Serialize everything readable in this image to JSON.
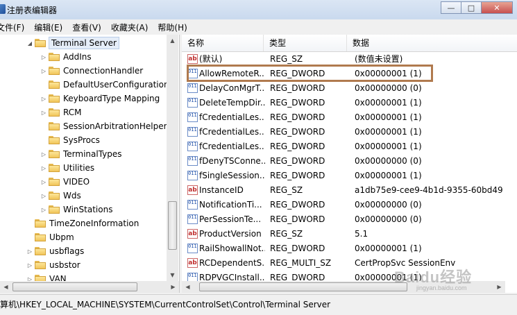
{
  "window": {
    "title": "注册表编辑器",
    "controls": {
      "minimize": "—",
      "maximize": "□",
      "close": "✕"
    }
  },
  "menu": [
    "文件(F)",
    "编辑(E)",
    "查看(V)",
    "收藏夹(A)",
    "帮助(H)"
  ],
  "tree": {
    "items": [
      {
        "label": "Terminal Server",
        "expandable": true,
        "expanded": true,
        "selected": true,
        "level": 0
      },
      {
        "label": "AddIns",
        "expandable": true,
        "level": 1
      },
      {
        "label": "ConnectionHandler",
        "expandable": true,
        "level": 1
      },
      {
        "label": "DefaultUserConfiguration",
        "expandable": false,
        "level": 1
      },
      {
        "label": "KeyboardType Mapping",
        "expandable": true,
        "level": 1
      },
      {
        "label": "RCM",
        "expandable": true,
        "level": 1
      },
      {
        "label": "SessionArbitrationHelper",
        "expandable": false,
        "level": 1
      },
      {
        "label": "SysProcs",
        "expandable": false,
        "level": 1
      },
      {
        "label": "TerminalTypes",
        "expandable": true,
        "level": 1
      },
      {
        "label": "Utilities",
        "expandable": true,
        "level": 1
      },
      {
        "label": "VIDEO",
        "expandable": true,
        "level": 1
      },
      {
        "label": "Wds",
        "expandable": true,
        "level": 1
      },
      {
        "label": "WinStations",
        "expandable": true,
        "level": 1
      },
      {
        "label": "TimeZoneInformation",
        "expandable": false,
        "level": 0
      },
      {
        "label": "Ubpm",
        "expandable": false,
        "level": 0
      },
      {
        "label": "usbflags",
        "expandable": true,
        "level": 0
      },
      {
        "label": "usbstor",
        "expandable": true,
        "level": 0
      },
      {
        "label": "VAN",
        "expandable": true,
        "level": 0
      }
    ]
  },
  "list": {
    "columns": [
      "名称",
      "类型",
      "数据"
    ],
    "rows": [
      {
        "icon": "string-value-icon",
        "name": "(默认)",
        "type": "REG_SZ",
        "data": "(数值未设置)"
      },
      {
        "icon": "binary-value-icon",
        "name": "AllowRemoteR...",
        "type": "REG_DWORD",
        "data": "0x00000001 (1)"
      },
      {
        "icon": "binary-value-icon",
        "name": "DelayConMgrT...",
        "type": "REG_DWORD",
        "data": "0x00000000 (0)"
      },
      {
        "icon": "binary-value-icon",
        "name": "DeleteTempDir...",
        "type": "REG_DWORD",
        "data": "0x00000001 (1)"
      },
      {
        "icon": "binary-value-icon",
        "name": "fCredentialLes...",
        "type": "REG_DWORD",
        "data": "0x00000001 (1)"
      },
      {
        "icon": "binary-value-icon",
        "name": "fCredentialLes...",
        "type": "REG_DWORD",
        "data": "0x00000001 (1)"
      },
      {
        "icon": "binary-value-icon",
        "name": "fCredentialLes...",
        "type": "REG_DWORD",
        "data": "0x00000001 (1)"
      },
      {
        "icon": "binary-value-icon",
        "name": "fDenyTSConne...",
        "type": "REG_DWORD",
        "data": "0x00000000 (0)"
      },
      {
        "icon": "binary-value-icon",
        "name": "fSingleSession...",
        "type": "REG_DWORD",
        "data": "0x00000001 (1)"
      },
      {
        "icon": "string-value-icon",
        "name": "InstanceID",
        "type": "REG_SZ",
        "data": "a1db75e9-cee9-4b1d-9355-60bd49"
      },
      {
        "icon": "binary-value-icon",
        "name": "NotificationTi...",
        "type": "REG_DWORD",
        "data": "0x00000000 (0)"
      },
      {
        "icon": "binary-value-icon",
        "name": "PerSessionTe...",
        "type": "REG_DWORD",
        "data": "0x00000000 (0)"
      },
      {
        "icon": "string-value-icon",
        "name": "ProductVersion",
        "type": "REG_SZ",
        "data": "5.1"
      },
      {
        "icon": "binary-value-icon",
        "name": "RailShowallNot...",
        "type": "REG_DWORD",
        "data": "0x00000001 (1)"
      },
      {
        "icon": "string-value-icon",
        "name": "RCDependentS...",
        "type": "REG_MULTI_SZ",
        "data": "CertPropSvc SessionEnv"
      },
      {
        "icon": "binary-value-icon",
        "name": "RDPVGCInstall...",
        "type": "REG_DWORD",
        "data": "0x00000001 (1)"
      }
    ]
  },
  "status": {
    "path": "计算机\\HKEY_LOCAL_MACHINE\\SYSTEM\\CurrentControlSet\\Control\\Terminal Server"
  },
  "watermark": {
    "brand": "Baidu经验",
    "url": "jingyan.baidu.com"
  },
  "colors": {
    "highlight_box": "#b07a4e",
    "selection": "#e5edf8"
  }
}
